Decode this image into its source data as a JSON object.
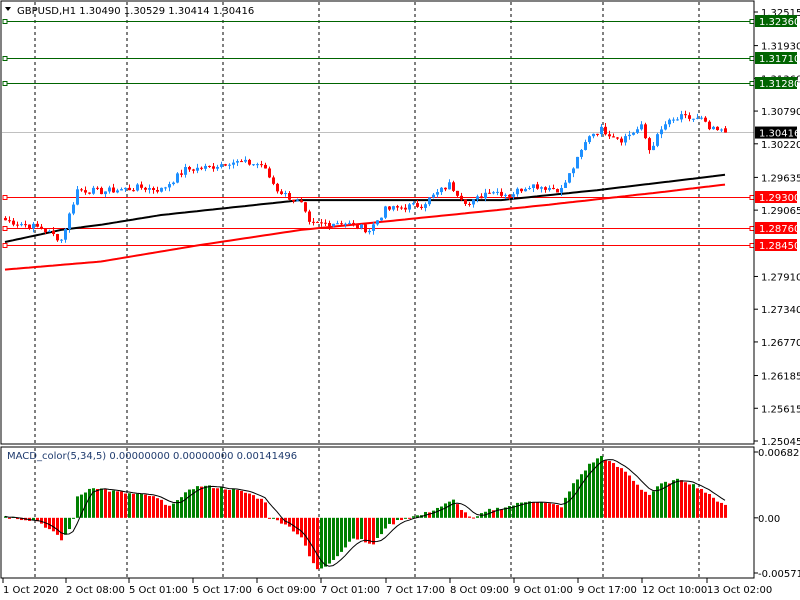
{
  "chart_data": {
    "type": "candlestick",
    "symbol": "GBPUSD",
    "timeframe": "H1",
    "header": "GBPUSD,H1  1.30490 1.30529 1.30414 1.30416",
    "ohlc_last": {
      "open": 1.3049,
      "high": 1.30529,
      "low": 1.30414,
      "close": 1.30416
    },
    "bar_count": 181,
    "price_axis": {
      "max": 1.32515,
      "min": 1.25045,
      "ticks": [
        "1.32515",
        "1.31930",
        "1.31360",
        "1.30790",
        "1.30220",
        "1.29635",
        "1.29065",
        "1.27910",
        "1.27340",
        "1.26770",
        "1.26185",
        "1.25615",
        "1.25045"
      ]
    },
    "time_labels": [
      "1 Oct 2020",
      "2 Oct 08:00",
      "5 Oct 01:00",
      "5 Oct 17:00",
      "6 Oct 09:00",
      "7 Oct 01:00",
      "7 Oct 17:00",
      "8 Oct 09:00",
      "9 Oct 01:00",
      "9 Oct 17:00",
      "12 Oct 10:00",
      "13 Oct 02:00"
    ],
    "close_keypoints": [
      [
        0,
        1.2889
      ],
      [
        9,
        1.2875
      ],
      [
        14,
        1.2855
      ],
      [
        18,
        1.2942
      ],
      [
        24,
        1.2939
      ],
      [
        34,
        1.2946
      ],
      [
        39,
        1.2942
      ],
      [
        45,
        1.2977
      ],
      [
        51,
        1.2981
      ],
      [
        56,
        1.2991
      ],
      [
        64,
        1.2986
      ],
      [
        68,
        1.2942
      ],
      [
        74,
        1.2916
      ],
      [
        76,
        1.2881
      ],
      [
        84,
        1.2886
      ],
      [
        91,
        1.2872
      ],
      [
        95,
        1.2907
      ],
      [
        104,
        1.2916
      ],
      [
        111,
        1.2951
      ],
      [
        116,
        1.2916
      ],
      [
        121,
        1.2942
      ],
      [
        126,
        1.2933
      ],
      [
        131,
        1.2951
      ],
      [
        139,
        1.2942
      ],
      [
        143,
        1.2994
      ],
      [
        146,
        1.3038
      ],
      [
        149,
        1.3047
      ],
      [
        154,
        1.303
      ],
      [
        159,
        1.3051
      ],
      [
        161,
        1.3012
      ],
      [
        165,
        1.3056
      ],
      [
        169,
        1.3068
      ],
      [
        174,
        1.3064
      ],
      [
        176,
        1.3047
      ],
      [
        180,
        1.30416
      ]
    ],
    "ma_black_keypoints": [
      [
        0,
        1.2851
      ],
      [
        14,
        1.2872
      ],
      [
        24,
        1.2881
      ],
      [
        39,
        1.2898
      ],
      [
        74,
        1.2924
      ],
      [
        124,
        1.2924
      ],
      [
        149,
        1.2942
      ],
      [
        180,
        1.2968
      ]
    ],
    "ma_red_keypoints": [
      [
        0,
        1.2803
      ],
      [
        24,
        1.2817
      ],
      [
        49,
        1.2846
      ],
      [
        74,
        1.2872
      ],
      [
        111,
        1.2898
      ],
      [
        136,
        1.2916
      ],
      [
        163,
        1.2937
      ],
      [
        180,
        1.2951
      ]
    ],
    "hlines": [
      {
        "price": 1.3236,
        "label": "1.32360",
        "color": "#006400"
      },
      {
        "price": 1.3171,
        "label": "1.31710",
        "color": "#006400"
      },
      {
        "price": 1.3128,
        "label": "1.31280",
        "color": "#006400"
      },
      {
        "price": 1.293,
        "label": "1.29300",
        "color": "#ff0000"
      },
      {
        "price": 1.2876,
        "label": "1.28760",
        "color": "#ff0000"
      },
      {
        "price": 1.2845,
        "label": "1.28450",
        "color": "#ff0000"
      }
    ],
    "current_price": {
      "price": 1.30416,
      "label": "1.30416"
    },
    "colors": {
      "bull": "#1e90ff",
      "bear": "#ff0000",
      "ma_black": "#000000",
      "ma_red": "#ff0000",
      "macd_up": "#008000",
      "macd_down": "#ff0000"
    },
    "macd": {
      "title": "MACD_color(5,34,5) 0.00000000 0.00000000 0.00141496",
      "max": 0.0068214,
      "min": -0.005717,
      "ticks": [
        "0.0068214",
        "0.00",
        "-0.005717"
      ],
      "keypoints": [
        [
          0,
          0.0002
        ],
        [
          1,
          0.0001
        ],
        [
          4,
          -0.0001
        ],
        [
          8,
          -0.0003
        ],
        [
          12,
          -0.0015
        ],
        [
          14,
          -0.0023
        ],
        [
          16,
          -0.0012
        ],
        [
          17,
          0.0
        ],
        [
          18,
          0.0021
        ],
        [
          21,
          0.003
        ],
        [
          22,
          0.0032
        ],
        [
          26,
          0.0028
        ],
        [
          31,
          0.0025
        ],
        [
          36,
          0.0023
        ],
        [
          39,
          0.0018
        ],
        [
          40,
          0.0012
        ],
        [
          41,
          0.0014
        ],
        [
          44,
          0.002
        ],
        [
          46,
          0.003
        ],
        [
          49,
          0.0033
        ],
        [
          52,
          0.0032
        ],
        [
          56,
          0.003
        ],
        [
          61,
          0.0025
        ],
        [
          65,
          0.0017
        ],
        [
          66,
          0.0
        ],
        [
          70,
          -0.0006
        ],
        [
          74,
          -0.002
        ],
        [
          76,
          -0.004
        ],
        [
          78,
          -0.0054
        ],
        [
          80,
          -0.005
        ],
        [
          84,
          -0.0035
        ],
        [
          87,
          -0.002
        ],
        [
          90,
          -0.0025
        ],
        [
          92,
          -0.0028
        ],
        [
          95,
          -0.001
        ],
        [
          99,
          -0.0001
        ],
        [
          104,
          0.0003
        ],
        [
          109,
          0.0012
        ],
        [
          112,
          0.0018
        ],
        [
          115,
          0.0005
        ],
        [
          117,
          -0.0001
        ],
        [
          121,
          0.0008
        ],
        [
          126,
          0.0012
        ],
        [
          131,
          0.0018
        ],
        [
          135,
          0.0015
        ],
        [
          139,
          0.0012
        ],
        [
          142,
          0.0035
        ],
        [
          146,
          0.0055
        ],
        [
          149,
          0.0064
        ],
        [
          151,
          0.0058
        ],
        [
          155,
          0.0048
        ],
        [
          159,
          0.003
        ],
        [
          161,
          0.0024
        ],
        [
          164,
          0.0035
        ],
        [
          169,
          0.004
        ],
        [
          174,
          0.003
        ],
        [
          177,
          0.002
        ],
        [
          180,
          0.0014
        ]
      ]
    }
  }
}
